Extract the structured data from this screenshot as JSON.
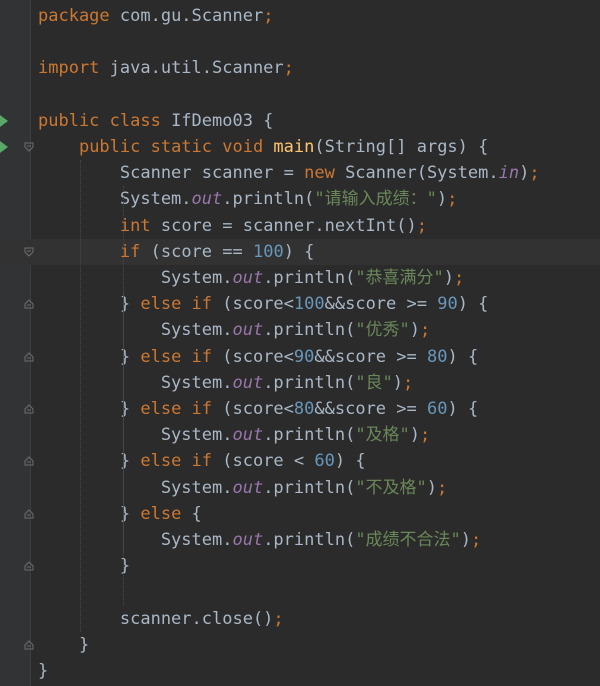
{
  "editor": {
    "language": "java",
    "theme": "darcula",
    "current_line_index": 9,
    "lines": [
      {
        "tokens": [
          {
            "t": "package ",
            "k": "kw"
          },
          {
            "t": "com.gu.Scanner",
            "k": "id"
          },
          {
            "t": ";",
            "k": "punc"
          }
        ]
      },
      {
        "tokens": []
      },
      {
        "tokens": [
          {
            "t": "import ",
            "k": "kw"
          },
          {
            "t": "java.util.Scanner",
            "k": "id"
          },
          {
            "t": ";",
            "k": "punc"
          }
        ]
      },
      {
        "tokens": []
      },
      {
        "tokens": [
          {
            "t": "public class ",
            "k": "kw"
          },
          {
            "t": "IfDemo03 {",
            "k": "id"
          }
        ]
      },
      {
        "tokens": [
          {
            "t": "    ",
            "k": "id"
          },
          {
            "t": "public static void ",
            "k": "kw"
          },
          {
            "t": "main",
            "k": "method"
          },
          {
            "t": "(String[] args) {",
            "k": "id"
          }
        ]
      },
      {
        "tokens": [
          {
            "t": "        Scanner scanner = ",
            "k": "id"
          },
          {
            "t": "new ",
            "k": "kw"
          },
          {
            "t": "Scanner(System.",
            "k": "id"
          },
          {
            "t": "in",
            "k": "field"
          },
          {
            "t": ")",
            "k": "id"
          },
          {
            "t": ";",
            "k": "punc"
          }
        ]
      },
      {
        "tokens": [
          {
            "t": "        System.",
            "k": "id"
          },
          {
            "t": "out",
            "k": "field"
          },
          {
            "t": ".println(",
            "k": "id"
          },
          {
            "t": "\"请输入成绩：\"",
            "k": "str"
          },
          {
            "t": ")",
            "k": "id"
          },
          {
            "t": ";",
            "k": "punc"
          }
        ]
      },
      {
        "tokens": [
          {
            "t": "        ",
            "k": "id"
          },
          {
            "t": "int ",
            "k": "kw"
          },
          {
            "t": "score = scanner.nextInt()",
            "k": "id"
          },
          {
            "t": ";",
            "k": "punc"
          }
        ]
      },
      {
        "tokens": [
          {
            "t": "        ",
            "k": "id"
          },
          {
            "t": "if ",
            "k": "kw"
          },
          {
            "t": "(score == ",
            "k": "id"
          },
          {
            "t": "100",
            "k": "num"
          },
          {
            "t": ") {",
            "k": "id"
          }
        ]
      },
      {
        "tokens": [
          {
            "t": "            System.",
            "k": "id"
          },
          {
            "t": "out",
            "k": "field"
          },
          {
            "t": ".println(",
            "k": "id"
          },
          {
            "t": "\"恭喜满分\"",
            "k": "str"
          },
          {
            "t": ")",
            "k": "id"
          },
          {
            "t": ";",
            "k": "punc"
          }
        ]
      },
      {
        "tokens": [
          {
            "t": "        } ",
            "k": "id"
          },
          {
            "t": "else if ",
            "k": "kw"
          },
          {
            "t": "(score<",
            "k": "id"
          },
          {
            "t": "100",
            "k": "num"
          },
          {
            "t": "&&score >= ",
            "k": "id"
          },
          {
            "t": "90",
            "k": "num"
          },
          {
            "t": ") {",
            "k": "id"
          }
        ]
      },
      {
        "tokens": [
          {
            "t": "            System.",
            "k": "id"
          },
          {
            "t": "out",
            "k": "field"
          },
          {
            "t": ".println(",
            "k": "id"
          },
          {
            "t": "\"优秀\"",
            "k": "str"
          },
          {
            "t": ")",
            "k": "id"
          },
          {
            "t": ";",
            "k": "punc"
          }
        ]
      },
      {
        "tokens": [
          {
            "t": "        } ",
            "k": "id"
          },
          {
            "t": "else if ",
            "k": "kw"
          },
          {
            "t": "(score<",
            "k": "id"
          },
          {
            "t": "90",
            "k": "num"
          },
          {
            "t": "&&score >= ",
            "k": "id"
          },
          {
            "t": "80",
            "k": "num"
          },
          {
            "t": ") {",
            "k": "id"
          }
        ]
      },
      {
        "tokens": [
          {
            "t": "            System.",
            "k": "id"
          },
          {
            "t": "out",
            "k": "field"
          },
          {
            "t": ".println(",
            "k": "id"
          },
          {
            "t": "\"良\"",
            "k": "str"
          },
          {
            "t": ")",
            "k": "id"
          },
          {
            "t": ";",
            "k": "punc"
          }
        ]
      },
      {
        "tokens": [
          {
            "t": "        } ",
            "k": "id"
          },
          {
            "t": "else if ",
            "k": "kw"
          },
          {
            "t": "(score<",
            "k": "id"
          },
          {
            "t": "80",
            "k": "num"
          },
          {
            "t": "&&score >= ",
            "k": "id"
          },
          {
            "t": "60",
            "k": "num"
          },
          {
            "t": ") {",
            "k": "id"
          }
        ]
      },
      {
        "tokens": [
          {
            "t": "            System.",
            "k": "id"
          },
          {
            "t": "out",
            "k": "field"
          },
          {
            "t": ".println(",
            "k": "id"
          },
          {
            "t": "\"及格\"",
            "k": "str"
          },
          {
            "t": ")",
            "k": "id"
          },
          {
            "t": ";",
            "k": "punc"
          }
        ]
      },
      {
        "tokens": [
          {
            "t": "        } ",
            "k": "id"
          },
          {
            "t": "else if ",
            "k": "kw"
          },
          {
            "t": "(score < ",
            "k": "id"
          },
          {
            "t": "60",
            "k": "num"
          },
          {
            "t": ") {",
            "k": "id"
          }
        ]
      },
      {
        "tokens": [
          {
            "t": "            System.",
            "k": "id"
          },
          {
            "t": "out",
            "k": "field"
          },
          {
            "t": ".println(",
            "k": "id"
          },
          {
            "t": "\"不及格\"",
            "k": "str"
          },
          {
            "t": ")",
            "k": "id"
          },
          {
            "t": ";",
            "k": "punc"
          }
        ]
      },
      {
        "tokens": [
          {
            "t": "        } ",
            "k": "id"
          },
          {
            "t": "else ",
            "k": "kw"
          },
          {
            "t": "{",
            "k": "id"
          }
        ]
      },
      {
        "tokens": [
          {
            "t": "            System.",
            "k": "id"
          },
          {
            "t": "out",
            "k": "field"
          },
          {
            "t": ".println(",
            "k": "id"
          },
          {
            "t": "\"成绩不合法\"",
            "k": "str"
          },
          {
            "t": ")",
            "k": "id"
          },
          {
            "t": ";",
            "k": "punc"
          }
        ]
      },
      {
        "tokens": [
          {
            "t": "        }",
            "k": "id"
          }
        ]
      },
      {
        "tokens": []
      },
      {
        "tokens": [
          {
            "t": "        scanner.close()",
            "k": "id"
          },
          {
            "t": ";",
            "k": "punc"
          }
        ]
      },
      {
        "tokens": [
          {
            "t": "    }",
            "k": "id"
          }
        ]
      },
      {
        "tokens": [
          {
            "t": "}",
            "k": "id"
          }
        ]
      }
    ],
    "gutter": {
      "run_markers": [
        4,
        5
      ],
      "fold_markers": [
        {
          "line": 5,
          "dir": "open"
        },
        {
          "line": 9,
          "dir": "open"
        },
        {
          "line": 11,
          "dir": "close"
        },
        {
          "line": 13,
          "dir": "close"
        },
        {
          "line": 15,
          "dir": "close"
        },
        {
          "line": 17,
          "dir": "close"
        },
        {
          "line": 19,
          "dir": "close"
        },
        {
          "line": 21,
          "dir": "close"
        },
        {
          "line": 24,
          "dir": "close"
        }
      ]
    }
  },
  "colors": {
    "background": "#2b2b2b",
    "gutter": "#313335",
    "current_line": "#323232",
    "keyword": "#cc7832",
    "number": "#6897bb",
    "string": "#6a8759",
    "field": "#9876aa",
    "method": "#ffc66d",
    "identifier": "#a9b7c6",
    "run_marker": "#59a869"
  }
}
